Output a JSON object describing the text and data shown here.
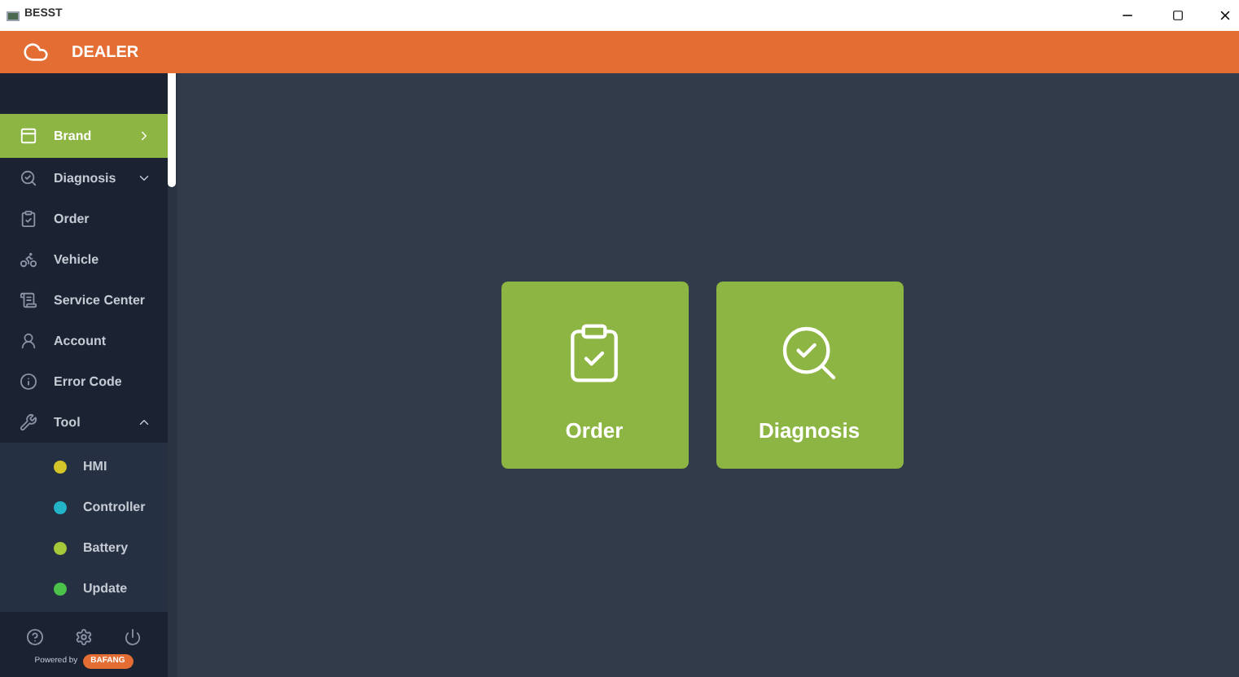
{
  "window": {
    "title": "BESST"
  },
  "header": {
    "title": "DEALER"
  },
  "sidebar": {
    "items": [
      {
        "label": "Brand",
        "selected": true
      },
      {
        "label": "Diagnosis",
        "selected": false,
        "expanded": false
      },
      {
        "label": "Order",
        "selected": false
      },
      {
        "label": "Vehicle",
        "selected": false
      },
      {
        "label": "Service Center",
        "selected": false
      },
      {
        "label": "Account",
        "selected": false
      },
      {
        "label": "Error Code",
        "selected": false
      },
      {
        "label": "Tool",
        "selected": false,
        "expanded": true,
        "children": [
          {
            "label": "HMI",
            "color": "#d4c62a"
          },
          {
            "label": "Controller",
            "color": "#22b5c8"
          },
          {
            "label": "Battery",
            "color": "#a6c93a"
          },
          {
            "label": "Update",
            "color": "#4cc24a"
          }
        ]
      }
    ],
    "footer": {
      "powered_by": "Powered by",
      "brand": "BAFANG"
    }
  },
  "cards": [
    {
      "label": "Order"
    },
    {
      "label": "Diagnosis"
    }
  ]
}
